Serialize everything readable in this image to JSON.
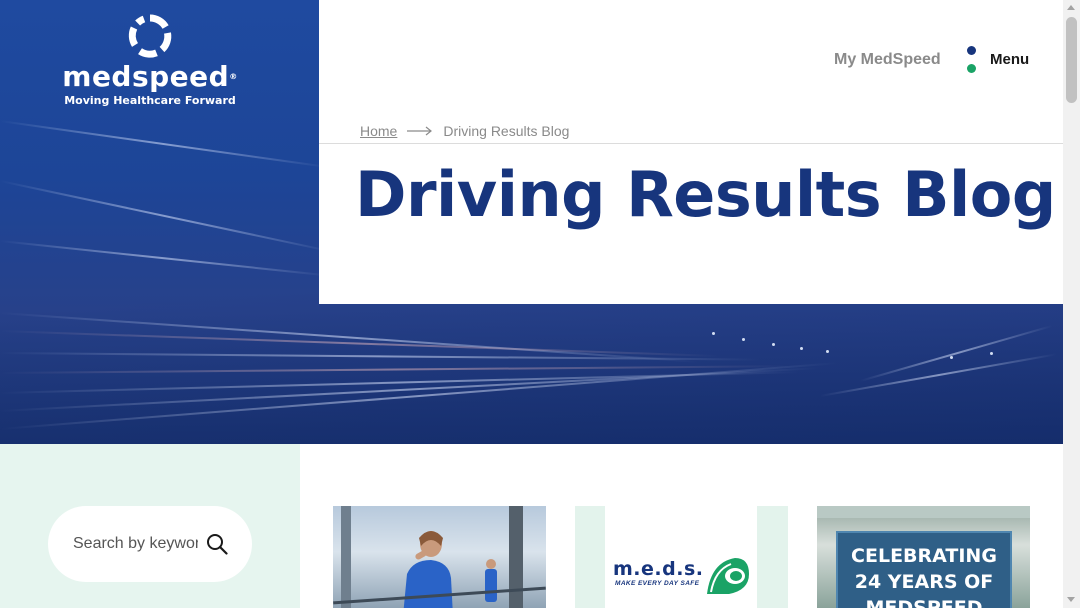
{
  "brand": {
    "name": "medspeed",
    "registered_mark": "®",
    "tagline": "Moving Healthcare Forward",
    "colors": {
      "navy": "#17357d",
      "green": "#1aa366",
      "hero_blue": "#1f4aa0",
      "mint": "#e6f5ef"
    }
  },
  "header": {
    "my_medspeed_label": "My MedSpeed",
    "menu_label": "Menu"
  },
  "breadcrumb": {
    "home_label": "Home",
    "current_label": "Driving Results Blog"
  },
  "page": {
    "title": "Driving Results Blog"
  },
  "search": {
    "placeholder": "Search by keyword"
  },
  "cards": [
    {
      "kind": "photo",
      "icon": "nurse-photo"
    },
    {
      "kind": "logo",
      "logo_word": "m.e.d.s.",
      "logo_sub": "MAKE EVERY DAY SAFE"
    },
    {
      "kind": "banner",
      "banner_lines": [
        "CELEBRATING",
        "24 YEARS OF",
        "MEDSPEED"
      ]
    }
  ],
  "icons": {
    "logo": "medspeed-ring-icon",
    "search": "search-icon",
    "breadcrumb_separator": "arrow-right-icon",
    "menu": "menu-dots-icon"
  }
}
